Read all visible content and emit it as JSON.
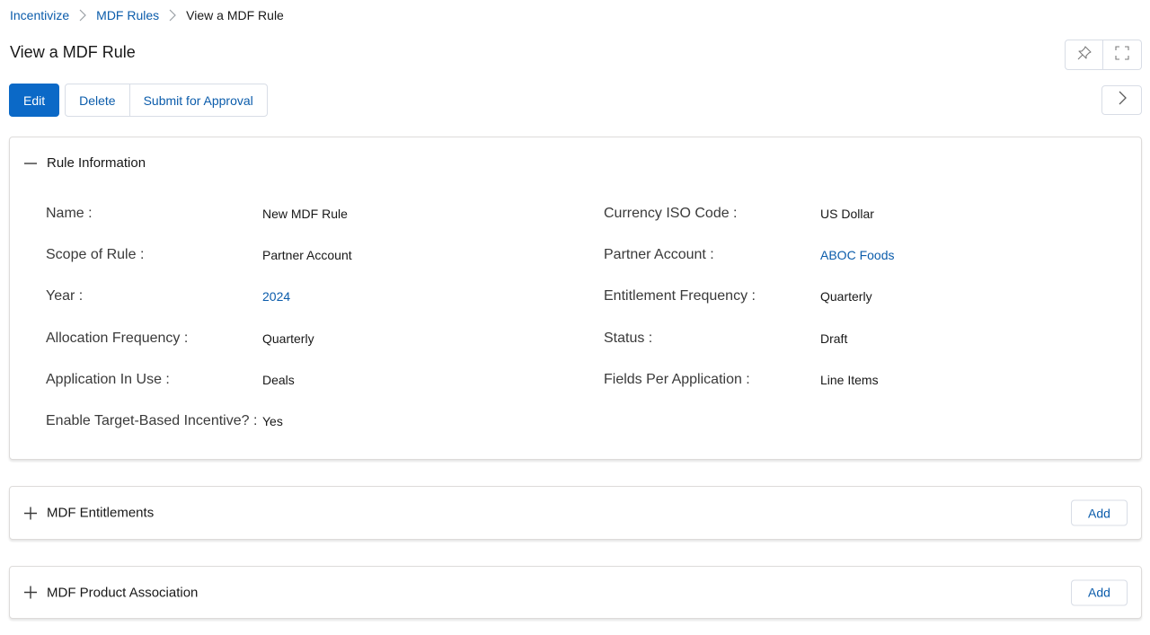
{
  "breadcrumb": {
    "items": [
      "Incentivize",
      "MDF Rules",
      "View a MDF Rule"
    ]
  },
  "page": {
    "title": "View a MDF Rule"
  },
  "toolbar": {
    "edit_label": "Edit",
    "delete_label": "Delete",
    "submit_label": "Submit for Approval",
    "pin_icon": "pin-icon",
    "expand_icon": "fullscreen-icon",
    "next_icon": "chevron-right-icon"
  },
  "rule_information": {
    "title": "Rule Information",
    "expanded": true,
    "left_fields": [
      {
        "label": "Name :",
        "value": "New MDF Rule",
        "link": false
      },
      {
        "label": "Scope of Rule :",
        "value": "Partner Account",
        "link": false
      },
      {
        "label": "Year :",
        "value": "2024",
        "link": true
      },
      {
        "label": "Allocation Frequency :",
        "value": "Quarterly",
        "link": false
      },
      {
        "label": "Application In Use :",
        "value": "Deals",
        "link": false
      },
      {
        "label": "Enable Target-Based Incentive? :",
        "value": "Yes",
        "link": false
      }
    ],
    "right_fields": [
      {
        "label": "Currency ISO Code :",
        "value": "US Dollar",
        "link": false
      },
      {
        "label": "Partner Account :",
        "value": "ABOC Foods",
        "link": true
      },
      {
        "label": "Entitlement Frequency :",
        "value": "Quarterly",
        "link": false
      },
      {
        "label": "Status :",
        "value": "Draft",
        "link": false
      },
      {
        "label": "Fields Per Application :",
        "value": "Line Items",
        "link": false
      }
    ]
  },
  "mdf_entitlements": {
    "title": "MDF Entitlements",
    "add_label": "Add",
    "expanded": false
  },
  "mdf_product_association": {
    "title": "MDF Product Association",
    "add_label": "Add",
    "expanded": false
  },
  "colors": {
    "link": "#0b5cab",
    "primary": "#0b69c7",
    "border": "#dddbda",
    "text": "#181818"
  }
}
